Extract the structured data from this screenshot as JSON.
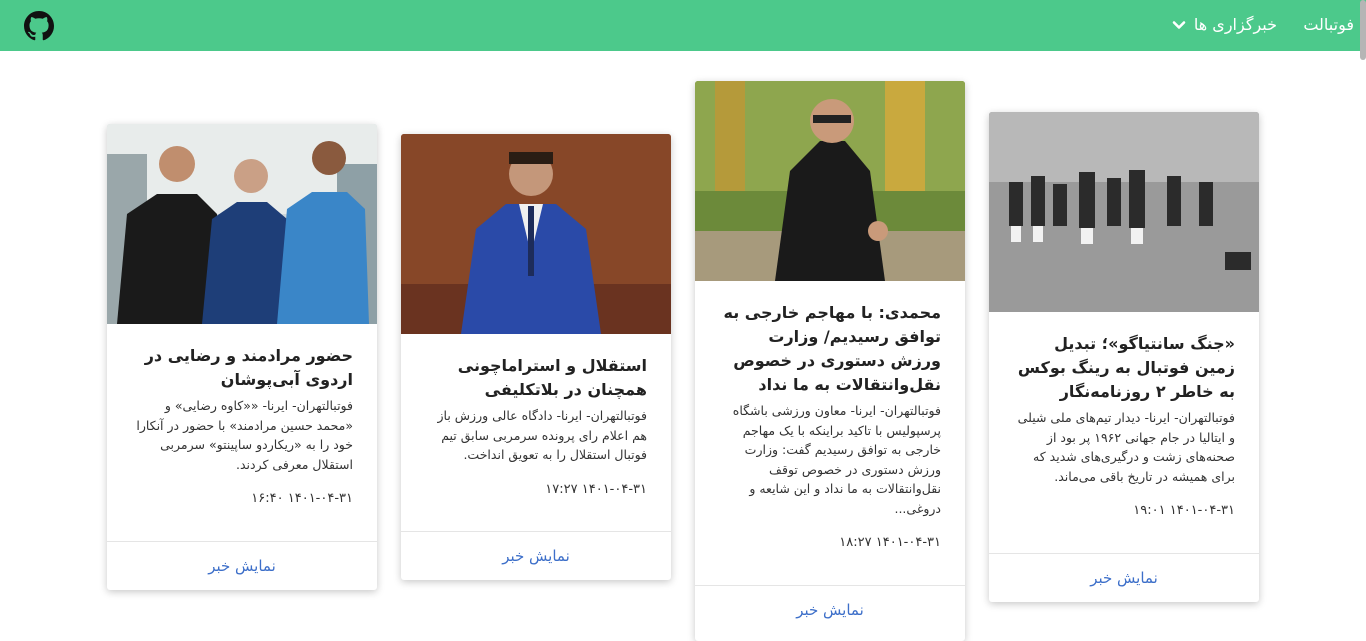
{
  "navbar": {
    "brand": "فوتبالت",
    "dropdown_label": "خبرگزاری ها",
    "github_icon": "github-icon",
    "bg_color": "#4cc98b"
  },
  "cards": [
    {
      "title": "«جنگ سانتیاگو»؛ تبدیل زمین فوتبال به رینگ بوکس به خاطر ۲ روزنامه‌نگار",
      "text": "فوتبالتهران- ایرنا- دیدار تیم‌های ملی شیلی و ایتالیا در جام جهانی ۱۹۶۲ پر بود از صحنه‌های زشت و درگیری‌های شدید که برای همیشه در تاریخ باقی می‌ماند.",
      "date": "۱۴۰۱-۰۴-۳۱ ۱۹:۰۱",
      "link": "نمایش خبر"
    },
    {
      "title": "محمدی: با مهاجم خارجی به توافق رسیدیم/ وزارت ورزش دستوری در خصوص نقل‌وانتقالات به ما نداد",
      "text": "فوتبالتهران- ایرنا- معاون ورزشی باشگاه پرسپولیس با تاکید براینکه با یک مهاجم خارجی به توافق رسیدیم گفت: وزارت ورزش دستوری در خصوص توقف نقل‌وانتقالات به ما نداد و این شایعه و دروغی...",
      "date": "۱۴۰۱-۰۴-۳۱ ۱۸:۲۷",
      "link": "نمایش خبر"
    },
    {
      "title": "استقلال و استراماچونی همچنان در بلاتکلیفی",
      "text": "فوتبالتهران- ایرنا- دادگاه عالی ورزش باز هم اعلام رای پرونده سرمربی سابق تیم فوتبال استقلال را به تعویق انداخت.",
      "date": "۱۴۰۱-۰۴-۳۱ ۱۷:۲۷",
      "link": "نمایش خبر"
    },
    {
      "title": "حضور مرادمند و رضایی در اردوی آبی‌پوشان",
      "text": "فوتبالتهران- ایرنا- ««کاوه رضایی» و «محمد حسین مرادمند» با حضور در آنکارا خود را به «ریکاردو ساپینتو» سرمربی استقلال معرفی کردند.",
      "date": "۱۴۰۱-۰۴-۳۱ ۱۶:۴۰",
      "link": "نمایش خبر"
    }
  ]
}
